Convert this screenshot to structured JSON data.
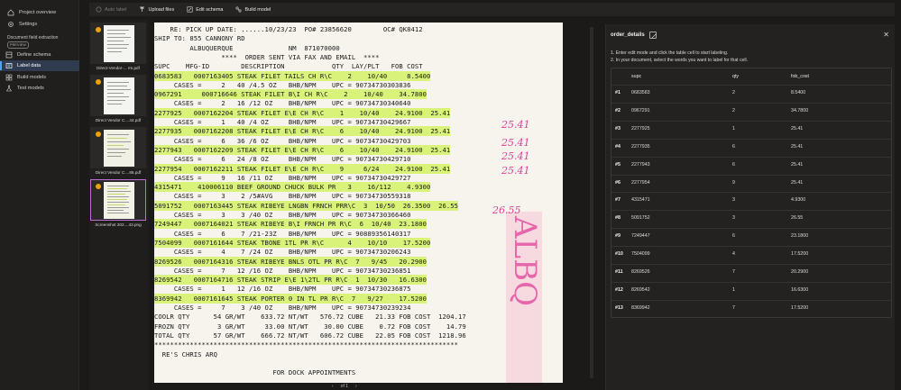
{
  "nav": {
    "items": [
      {
        "label": "Project overview",
        "icon": "home-icon",
        "active": false
      },
      {
        "label": "Settings",
        "icon": "gear-icon",
        "active": false
      }
    ],
    "section_label": "Document field extraction",
    "section_badge": "PREVIEW",
    "sub_items": [
      {
        "label": "Define schema",
        "icon": "schema-icon",
        "active": false
      },
      {
        "label": "Label data",
        "icon": "label-icon",
        "active": true
      },
      {
        "label": "Build models",
        "icon": "models-icon",
        "active": false
      },
      {
        "label": "Test models",
        "icon": "test-icon",
        "active": false
      }
    ]
  },
  "toolbar": {
    "auto_label": "Auto label",
    "upload_files": "Upload files",
    "edit_schema": "Edit schema",
    "build_model": "Build model"
  },
  "thumbnails": [
    {
      "caption": "Direct-Vendor-... rm.pdf",
      "selected": false
    },
    {
      "caption": "Direct Vendor C....44.pdf",
      "selected": false
    },
    {
      "caption": "Direct Vendor C....86.pdf",
      "selected": false
    },
    {
      "caption": "Screenshot 202....43.png",
      "selected": true
    }
  ],
  "document": {
    "lines": [
      "    RE: PICK UP DATE: ......10/23/23  PO# 23856620        OC# QK8412",
      "SHIP TO: 855 CANNONY RD",
      "         ALBUQUERQUE              NM  871070000",
      "                 ****  ORDER SENT VIA FAX AND EMAIL  ****",
      "SUPC    MFG-ID        DESCRIPTION            QTY  LAY/PLT   FOB COST",
      "0683583   0007163405 STEAK FILET TAILS CH R\\C    2    10/40     8.5400",
      "     CASES =     2   40 /4.5 OZ   BHB/NPM    UPC = 90734730303836",
      "0967291     000716646 STEAK FILET B\\I CH R\\C    2    10/40    34.7800",
      "     CASES =     2   16 /12 OZ    BHB/NPM    UPC = 90734730340640",
      "2277925   0007162204 STEAK FILET E\\E CH R\\C    1    10/40    24.9100  25.41",
      "     CASES =     1   40 /4 OZ     BHB/NPM    UPC = 90734730429667",
      "2277935   0007162208 STEAK FILET E\\E CH R\\C    6    10/40    24.9100  25.41",
      "     CASES =     6   36 /6 OZ     BHB/NPM    UPC = 90734730429703",
      "2277943   0007162209 STEAK FILET E\\E CH R\\C    6    10/40    24.9100  25.41",
      "     CASES =     6   24 /8 OZ     BHB/NPM    UPC = 90734730429710",
      "2277954   0007162211 STEAK FILET E\\E CH R\\C    9     6/24    24.9100  25.41",
      "     CASES =     9   16 /11 OZ    BHB/NPM    UPC = 90734730429727",
      "4315471    410006110 BEEF GROUND CHUCK BULK PR   3    16/112    4.9300",
      "     CASES =     3    2 /5#AVG    BHB/NPM    UPC = 90734730559318",
      "5091752   0007163445 STEAK RIBEYE LNGBN FRNCH PRR\\C  3  10/50  26.3500  26.55",
      "     CASES =     3    3 /40 OZ    BHB/NPM    UPC = 90734730366460",
      "7249447   0007164021 STEAK RIBEYE B\\I FRNCH PR R\\C  6  10/40  23.1800",
      "     CASES =     6    7 /21-23Z   BHB/NPM    UPC = 90889356140317",
      "7504099   0007161644 STEAK TBONE 1TL PR R\\C      4    10/10    17.5200",
      "     CASES =     4    7 /24 OZ    BHB/NPM    UPC = 90734730206243",
      "8269526   0007164316 STEAK RIBEYE BNLS OTL PR R\\C  7   9/45   20.2900",
      "     CASES =     7   12 /16 OZ    BHB/NPM    UPC = 90734730236851",
      "8269542   0007164716 STEAK STRIP E\\E 1\\2TL PR R\\C  1  10/30   16.6300",
      "     CASES =     1   12 /16 OZ    BHB/NPM    UPC = 90734730236875",
      "8369942   0007161645 STEAK PORTER 0 IN TL PR R\\C  7   9/27    17.5200",
      "     CASES =     7    3 /40 OZ    BHB/NPM    UPC = 90734730239234",
      "COOLR QTY      54 GR/WT    633.72 NT/WT   576.72 CUBE   21.33 FOB COST  1204.17",
      "FROZN QTY       3 GR/WT     33.00 NT/WT    30.00 CUBE    0.72 FOB COST    14.79",
      "TOTAL QTY      57 GR/WT    666.72 NT/WT   606.72 CUBE   22.05 FOB COST  1218.96",
      "*****************************************************************************",
      "  RE'S CHRIS ARQ",
      "",
      "                              FOR DOCK APPOINTMENTS"
    ],
    "page_indicator": "of 1",
    "handwritten": [
      "25.41",
      "25.41",
      "25.41",
      "25.41",
      "26.55"
    ],
    "handwritten_big": "ALBQ"
  },
  "panel": {
    "title": "order_details",
    "instructions": [
      "1. Enter edit mode and click the table cell to start labeling.",
      "2. In your document, select the words you want to label for that cell."
    ],
    "columns": [
      "",
      "supc",
      "qty",
      "fob_cost"
    ],
    "rows": [
      {
        "num": "#1",
        "supc": "0683583",
        "qty": "2",
        "fob_cost": "8.5400"
      },
      {
        "num": "#2",
        "supc": "0967291",
        "qty": "2",
        "fob_cost": "34.7800"
      },
      {
        "num": "#3",
        "supc": "2277925",
        "qty": "1",
        "fob_cost": "25.41"
      },
      {
        "num": "#4",
        "supc": "2277935",
        "qty": "6",
        "fob_cost": "25.41"
      },
      {
        "num": "#5",
        "supc": "2277943",
        "qty": "6",
        "fob_cost": "25.41"
      },
      {
        "num": "#6",
        "supc": "2277954",
        "qty": "9",
        "fob_cost": "25.41"
      },
      {
        "num": "#7",
        "supc": "4315471",
        "qty": "3",
        "fob_cost": "4.9300"
      },
      {
        "num": "#8",
        "supc": "5091752",
        "qty": "3",
        "fob_cost": "26.55"
      },
      {
        "num": "#9",
        "supc": "7249447",
        "qty": "6",
        "fob_cost": "23.1800"
      },
      {
        "num": "#10",
        "supc": "7504099",
        "qty": "4",
        "fob_cost": "17.5200"
      },
      {
        "num": "#11",
        "supc": "8269526",
        "qty": "7",
        "fob_cost": "20.2900"
      },
      {
        "num": "#12",
        "supc": "8269542",
        "qty": "1",
        "fob_cost": "16.6300"
      },
      {
        "num": "#13",
        "supc": "8369942",
        "qty": "7",
        "fob_cost": "17.5200"
      }
    ]
  },
  "colors": {
    "accent": "#4fa3f7",
    "selected_thumb": "#c06cd6",
    "status_dot": "#f2a100",
    "highlight": "#d9f27a",
    "handwriting": "#e0409a",
    "overlay_pink": "#f6a8c8"
  }
}
